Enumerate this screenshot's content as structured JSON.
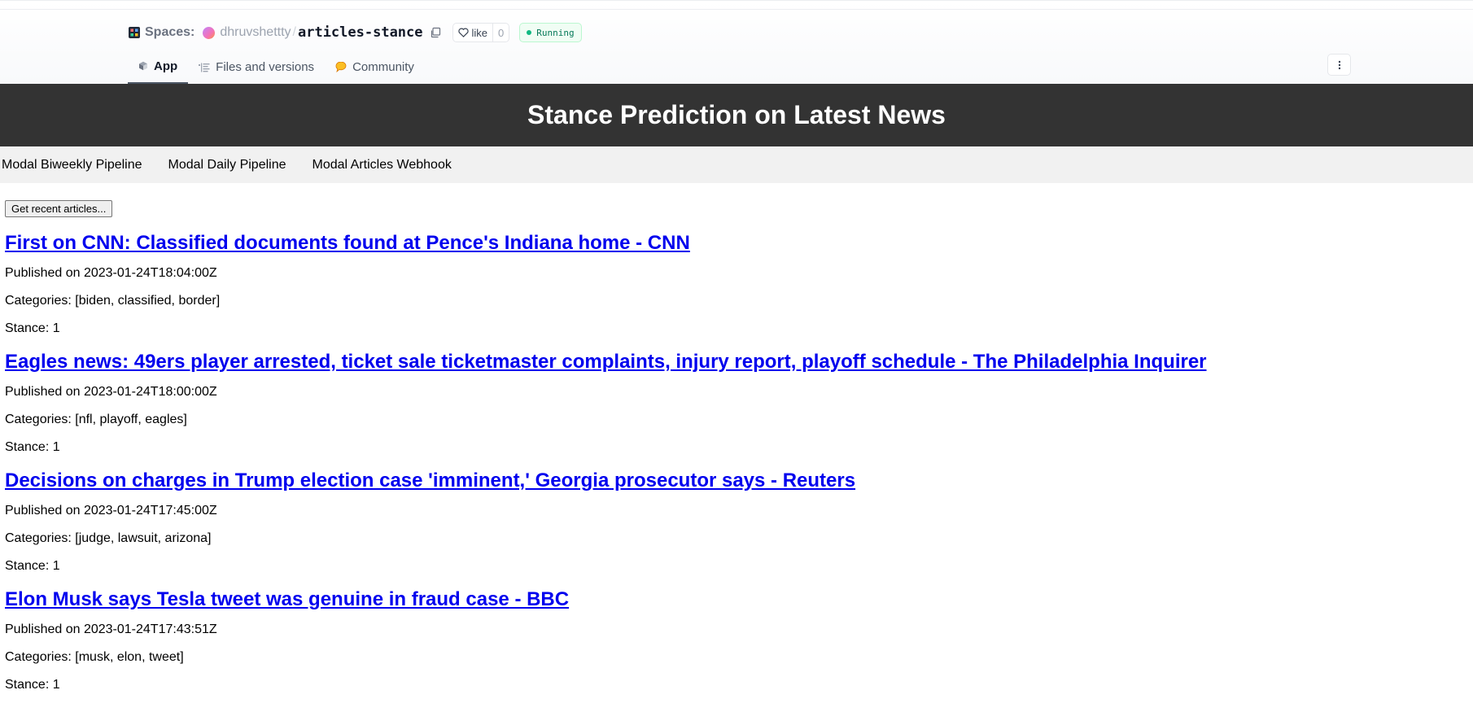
{
  "header": {
    "spaces_label": "Spaces:",
    "owner": "dhruvshettty",
    "separator": "/",
    "repo": "articles-stance",
    "like_label": "like",
    "like_count": "0",
    "status": "Running",
    "tabs": [
      {
        "label": "App",
        "icon": "cube-icon",
        "active": true
      },
      {
        "label": "Files and versions",
        "icon": "files-icon",
        "active": false
      },
      {
        "label": "Community",
        "icon": "community-icon",
        "active": false
      }
    ]
  },
  "app": {
    "title": "Stance Prediction on Latest News",
    "nav": [
      "Modal Biweekly Pipeline",
      "Modal Daily Pipeline",
      "Modal Articles Webhook"
    ],
    "button_label": "Get recent articles...",
    "articles": [
      {
        "title": "First on CNN: Classified documents found at Pence's Indiana home - CNN",
        "published": "Published on 2023-01-24T18:04:00Z",
        "categories": "Categories: [biden, classified, border]",
        "stance": "Stance: 1"
      },
      {
        "title": "Eagles news: 49ers player arrested, ticket sale ticketmaster complaints, injury report, playoff schedule - The Philadelphia Inquirer",
        "published": "Published on 2023-01-24T18:00:00Z",
        "categories": "Categories: [nfl, playoff, eagles]",
        "stance": "Stance: 1"
      },
      {
        "title": "Decisions on charges in Trump election case 'imminent,' Georgia prosecutor says - Reuters",
        "published": "Published on 2023-01-24T17:45:00Z",
        "categories": "Categories: [judge, lawsuit, arizona]",
        "stance": "Stance: 1"
      },
      {
        "title": "Elon Musk says Tesla tweet was genuine in fraud case - BBC",
        "published": "Published on 2023-01-24T17:43:51Z",
        "categories": "Categories: [musk, elon, tweet]",
        "stance": "Stance: 1"
      }
    ]
  },
  "colors": {
    "title_bar": "#333333",
    "nav_bar": "#f1f1f1",
    "link": "#0000ee",
    "status": "#047857"
  }
}
